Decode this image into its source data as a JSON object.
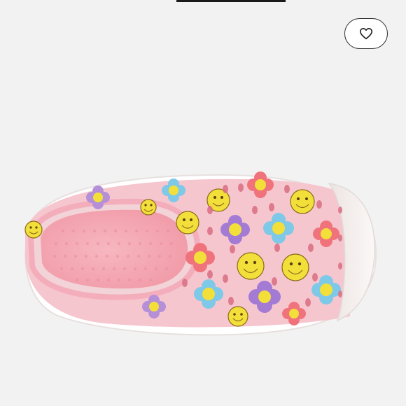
{
  "listing": {
    "product_image_subject": "shoe",
    "like_button": {
      "icon": "heart-outline-icon"
    }
  },
  "colors": {
    "background": "#f2f2f2",
    "shoe_pink": "#f6c6cf",
    "toe_cap": "#f7f3f1",
    "sole": "#ffffff",
    "smiley_yellow": "#f3df3a"
  }
}
